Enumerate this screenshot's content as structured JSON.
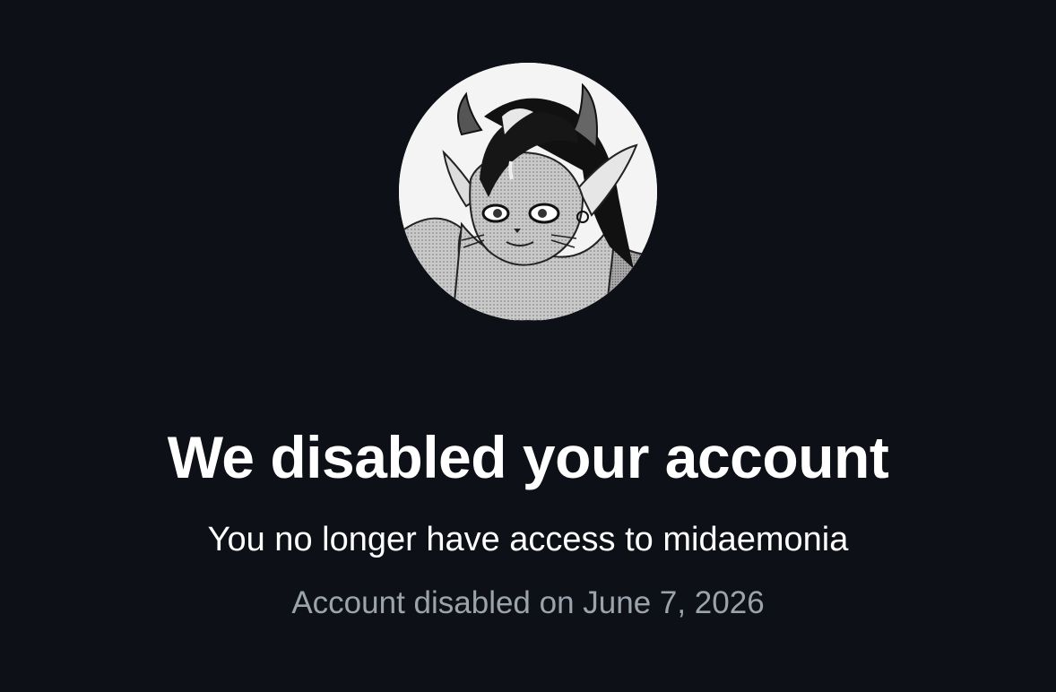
{
  "avatar": {
    "icon": "profile-avatar-demon-cat-girl"
  },
  "status": {
    "title": "We disabled your account",
    "message": "You no longer have access to midaemonia",
    "date_line": "Account disabled on June 7, 2026"
  },
  "colors": {
    "background": "#0d1016",
    "title": "#ffffff",
    "subtitle": "#ffffff",
    "muted": "#9ba3ad"
  }
}
